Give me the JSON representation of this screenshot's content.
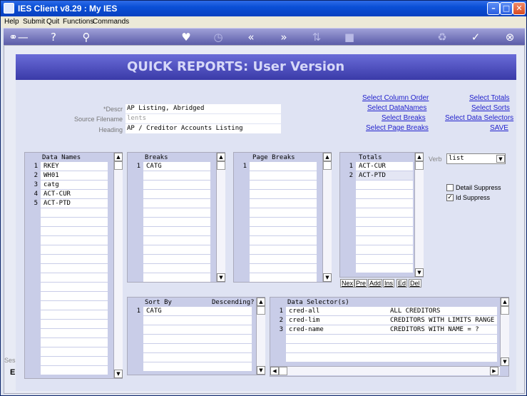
{
  "window": {
    "title": "IES Client v8.29 : My IES"
  },
  "menu": [
    "Help",
    "Submit",
    "Quit",
    "Functions",
    "Commands"
  ],
  "banner": {
    "title": "QUICK REPORTS: User Version"
  },
  "form": {
    "descr": {
      "label": "*Descr",
      "value": "AP Listing, Abridged"
    },
    "source": {
      "label": "Source Filename",
      "value": "lents"
    },
    "heading": {
      "label": "Heading",
      "value": "AP / Creditor Accounts Listing"
    }
  },
  "links": {
    "col_order": "Select Column Order",
    "data_names": "Select DataNames",
    "breaks": "Select Breaks",
    "page_breaks": "Select Page Breaks",
    "totals": "Select Totals",
    "sorts": "Select Sorts",
    "selectors": "Select Data Selectors",
    "save": "SAVE"
  },
  "data_names": {
    "header": "Data Names",
    "items": [
      {
        "n": "1",
        "v": "RKEY"
      },
      {
        "n": "2",
        "v": "WH01"
      },
      {
        "n": "3",
        "v": "catg"
      },
      {
        "n": "4",
        "v": "ACT-CUR"
      },
      {
        "n": "5",
        "v": "ACT-PTD"
      }
    ]
  },
  "breaks": {
    "header": "Breaks",
    "items": [
      {
        "n": "1",
        "v": "CATG"
      }
    ]
  },
  "page_breaks": {
    "header": "Page Breaks",
    "items": [
      {
        "n": "1",
        "v": ""
      }
    ]
  },
  "totals": {
    "header": "Totals",
    "items": [
      {
        "n": "1",
        "v": "ACT-CUR"
      },
      {
        "n": "2",
        "v": "ACT-PTD"
      }
    ],
    "buttons": [
      "Nex",
      "Pre",
      "Add",
      "Ins",
      "Ed",
      "Del"
    ]
  },
  "verb": {
    "label": "Verb",
    "value": "list"
  },
  "options": {
    "detail_suppress": {
      "label": "Detail Suppress",
      "checked": false
    },
    "id_suppress": {
      "label": "Id Suppress",
      "checked": true
    }
  },
  "sort_by": {
    "header": "Sort By",
    "header2": "Descending?",
    "items": [
      {
        "n": "1",
        "v": "CATG"
      }
    ]
  },
  "selectors": {
    "header": "Data Selector(s)",
    "items": [
      {
        "n": "1",
        "v": "cred-all",
        "d": "ALL CREDITORS"
      },
      {
        "n": "2",
        "v": "cred-lim",
        "d": "CREDITORS WITH LIMITS RANGE"
      },
      {
        "n": "3",
        "v": "cred-name",
        "d": "CREDITORS WITH NAME = ?"
      }
    ]
  },
  "side_text": {
    "ses": "Ses",
    "e": "E"
  }
}
